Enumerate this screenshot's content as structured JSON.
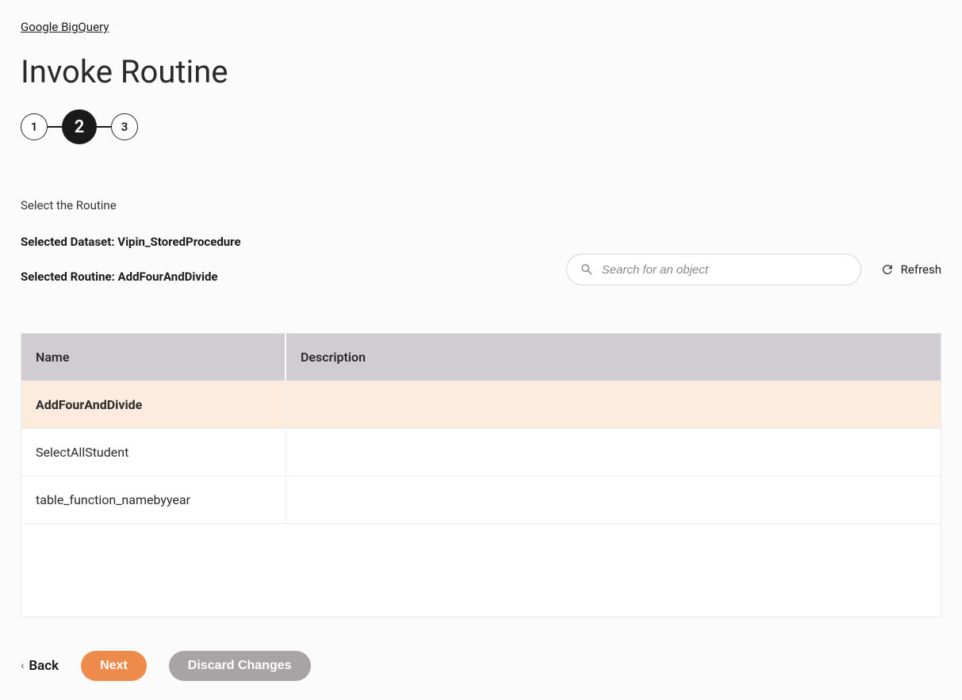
{
  "breadcrumb": {
    "label": "Google BigQuery"
  },
  "page_title": "Invoke Routine",
  "stepper": {
    "steps": [
      "1",
      "2",
      "3"
    ],
    "active_index": 1
  },
  "section_label": "Select the Routine",
  "selected_dataset_label": "Selected Dataset: Vipin_StoredProcedure",
  "selected_routine_label": "Selected Routine: AddFourAndDivide",
  "search": {
    "placeholder": "Search for an object"
  },
  "refresh_label": "Refresh",
  "table": {
    "headers": {
      "name": "Name",
      "description": "Description"
    },
    "rows": [
      {
        "name": "AddFourAndDivide",
        "description": "",
        "selected": true
      },
      {
        "name": "SelectAllStudent",
        "description": "",
        "selected": false
      },
      {
        "name": "table_function_namebyyear",
        "description": "",
        "selected": false
      }
    ]
  },
  "actions": {
    "back": "Back",
    "next": "Next",
    "discard": "Discard Changes"
  }
}
